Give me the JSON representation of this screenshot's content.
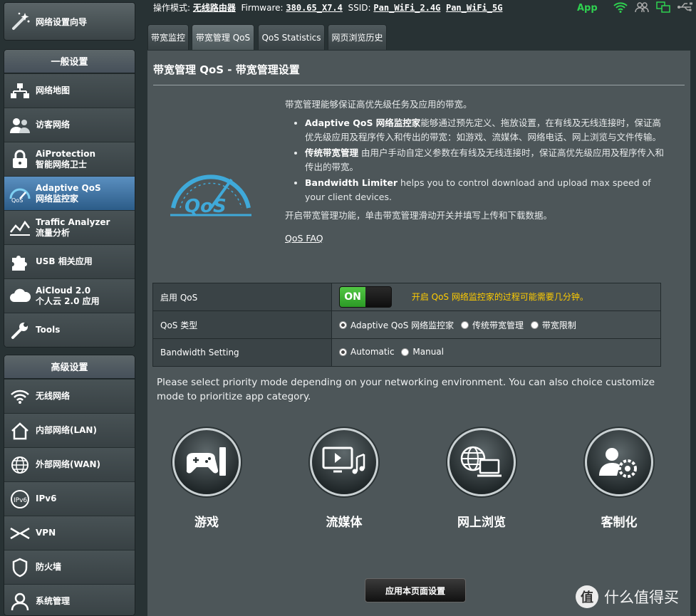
{
  "sidebar": {
    "wizard_label": "网络设置向导",
    "general_header": "一般设置",
    "general_items": [
      {
        "line1": "网络地图",
        "line2": "",
        "icon": "network-map-icon"
      },
      {
        "line1": "访客网络",
        "line2": "",
        "icon": "guest-network-icon"
      },
      {
        "line1": "AiProtection",
        "line2": "智能网络卫士",
        "icon": "aiprotection-icon"
      },
      {
        "line1": "Adaptive QoS",
        "line2": "网络监控家",
        "icon": "qos-icon",
        "active": true
      },
      {
        "line1": "Traffic Analyzer",
        "line2": "流量分析",
        "icon": "traffic-analyzer-icon"
      },
      {
        "line1": "USB 相关应用",
        "line2": "",
        "icon": "usb-app-icon"
      },
      {
        "line1": "AiCloud 2.0",
        "line2": "个人云 2.0 应用",
        "icon": "aicloud-icon"
      },
      {
        "line1": "Tools",
        "line2": "",
        "icon": "tools-icon"
      }
    ],
    "advanced_header": "高级设置",
    "advanced_items": [
      {
        "line1": "无线网络",
        "icon": "wireless-icon"
      },
      {
        "line1": "内部网络(LAN)",
        "icon": "lan-icon"
      },
      {
        "line1": "外部网络(WAN)",
        "icon": "wan-icon"
      },
      {
        "line1": "IPv6",
        "icon": "ipv6-icon"
      },
      {
        "line1": "VPN",
        "icon": "vpn-icon"
      },
      {
        "line1": "防火墙",
        "icon": "firewall-icon"
      },
      {
        "line1": "系统管理",
        "icon": "admin-icon"
      }
    ]
  },
  "topbar": {
    "mode_label": "操作模式:",
    "mode_value": "无线路由器",
    "firmware_label": "Firmware:",
    "firmware_value": "380.65_X7.4",
    "ssid_label": "SSID:",
    "ssid_1": "Pan_WiFi_2.4G",
    "ssid_2": "Pan_WiFi_5G",
    "app_label": "App"
  },
  "tabs": [
    {
      "label": "带宽监控",
      "active": false
    },
    {
      "label": "带宽管理 QoS",
      "active": true
    },
    {
      "label": "QoS Statistics",
      "active": false
    },
    {
      "label": "网页浏览历史",
      "active": false
    }
  ],
  "content": {
    "title": "带宽管理 QoS - 带宽管理设置",
    "intro": "带宽管理能够保证高优先级任务及应用的带宽。",
    "bullet1_bold": "Adaptive QoS 网络监控家",
    "bullet1_text": "能够通过预先定义、拖放设置，在有线及无线连接时，保证高优先级应用及程序传入和传出的带宽：如游戏、流媒体、网络电话、网上浏览与文件传输。",
    "bullet2_bold": "传统带宽管理",
    "bullet2_text": " 由用户手动自定义参数在有线及无线连接时，保证高优先级应用及程序传入和传出的带宽。",
    "bullet3_bold": "Bandwidth Limiter",
    "bullet3_text": " helps you to control download and upload max speed of your client devices.",
    "enable_hint": "开启带宽管理功能，单击带宽管理滑动开关并填写上传和下载数据。",
    "faq_link": "QoS FAQ",
    "logo_text": "QoS"
  },
  "settings": {
    "enable_label": "启用 QoS",
    "toggle_state": "ON",
    "enable_warning": "开启 QoS 网络监控家的过程可能需要几分钟。",
    "type_label": "QoS 类型",
    "type_options": [
      "Adaptive QoS 网络监控家",
      "传统带宽管理",
      "带宽限制"
    ],
    "type_selected": 0,
    "bandwidth_label": "Bandwidth Setting",
    "bandwidth_options": [
      "Automatic",
      "Manual"
    ],
    "bandwidth_selected": 0
  },
  "modes": {
    "prompt": "Please select priority mode depending on your networking environment. You can also choice customize mode to prioritize app category.",
    "items": [
      {
        "label": "游戏",
        "icon": "gamepad-icon"
      },
      {
        "label": "流媒体",
        "icon": "media-streaming-icon"
      },
      {
        "label": "网上浏览",
        "icon": "web-browsing-icon"
      },
      {
        "label": "客制化",
        "icon": "customize-icon"
      }
    ]
  },
  "apply_button": "应用本页面设置",
  "watermark": {
    "mark": "值",
    "text": "什么值得买"
  },
  "colors": {
    "accent_blue": "#3fa9d9",
    "active_menu": "#2c5c88",
    "warning": "#ffcc00",
    "on_green": "#2c9a26",
    "app_green": "#2fd150"
  }
}
